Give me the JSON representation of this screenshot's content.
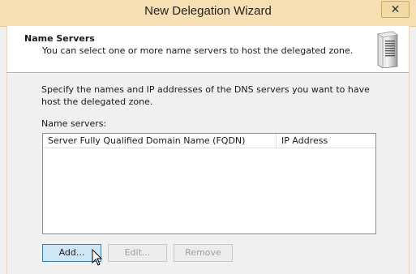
{
  "window": {
    "title": "New Delegation Wizard",
    "close_glyph": "✕"
  },
  "header": {
    "title": "Name Servers",
    "subtitle": "You can select one or more name servers to host the delegated zone.",
    "icon": "server-icon"
  },
  "content": {
    "description": "Specify the names and IP addresses of the DNS servers you want to have host the delegated zone.",
    "list_label": "Name servers:",
    "columns": [
      "Server Fully Qualified Domain Name (FQDN)",
      "IP Address"
    ],
    "rows": []
  },
  "buttons": {
    "add": "Add...",
    "edit": "Edit...",
    "remove": "Remove"
  },
  "colors": {
    "titlebar": "#f5dfb3",
    "primary_button": "#cfe6f7"
  }
}
